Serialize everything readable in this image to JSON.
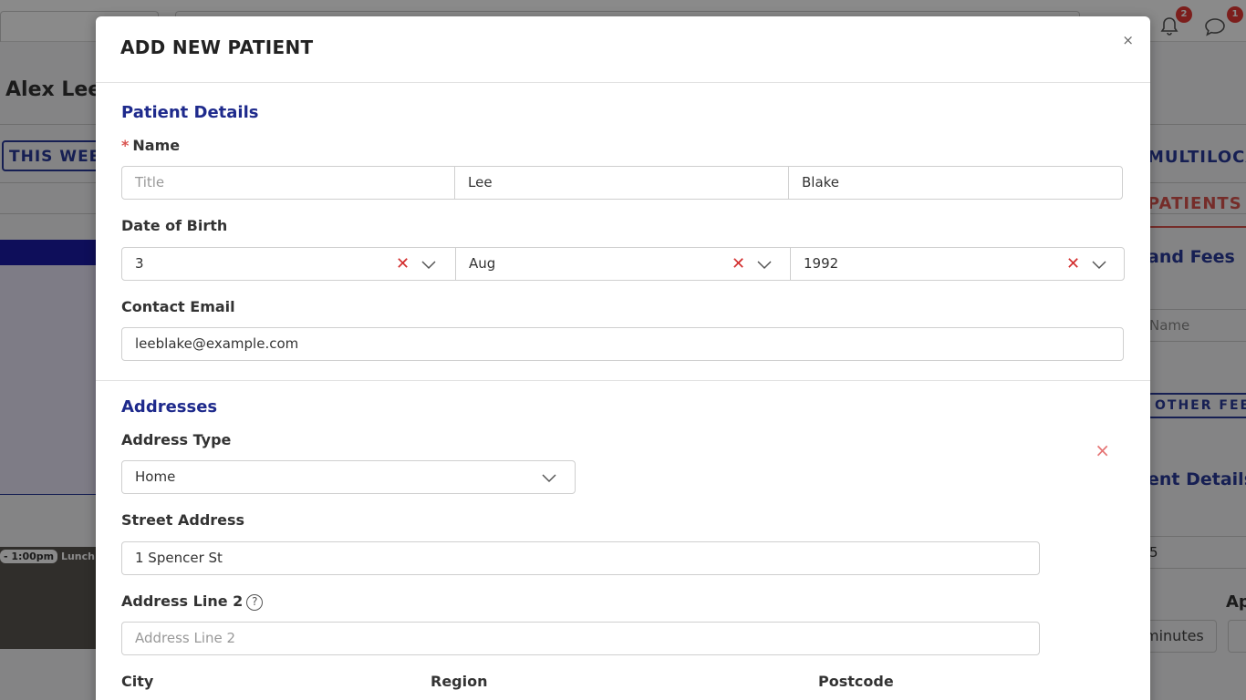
{
  "background": {
    "user_name": "Alex Lee",
    "week_button": "THIS WEEK",
    "time_pill": "- 1:00pm",
    "time_text": "Lunch br",
    "notifications_count": "2",
    "messages_count": "1",
    "right_tab": "MULTILOCATION",
    "right_patients": "PATIENTS",
    "right_fees": "and Fees",
    "right_name_placeholder": "Name",
    "right_other_fee": "OTHER FEE",
    "right_details": "ent Details",
    "right_num": "5",
    "right_ap": "Ap",
    "right_minutes": "minutes"
  },
  "modal": {
    "title": "ADD NEW PATIENT",
    "close": "×",
    "patient_details": {
      "heading": "Patient Details",
      "name_label": "Name",
      "required_mark": "*",
      "title_placeholder": "Title",
      "first_name": "Lee",
      "last_name": "Blake",
      "dob_label": "Date of Birth",
      "dob_day": "3",
      "dob_month": "Aug",
      "dob_year": "1992",
      "email_label": "Contact Email",
      "email_value": "leeblake@example.com"
    },
    "addresses": {
      "heading": "Addresses",
      "type_label": "Address Type",
      "type_value": "Home",
      "street_label": "Street Address",
      "street_value": "1 Spencer St",
      "line2_label": "Address Line 2",
      "line2_placeholder": "Address Line 2",
      "help": "?",
      "city_label": "City",
      "region_label": "Region",
      "postcode_label": "Postcode",
      "remove": "×"
    }
  }
}
